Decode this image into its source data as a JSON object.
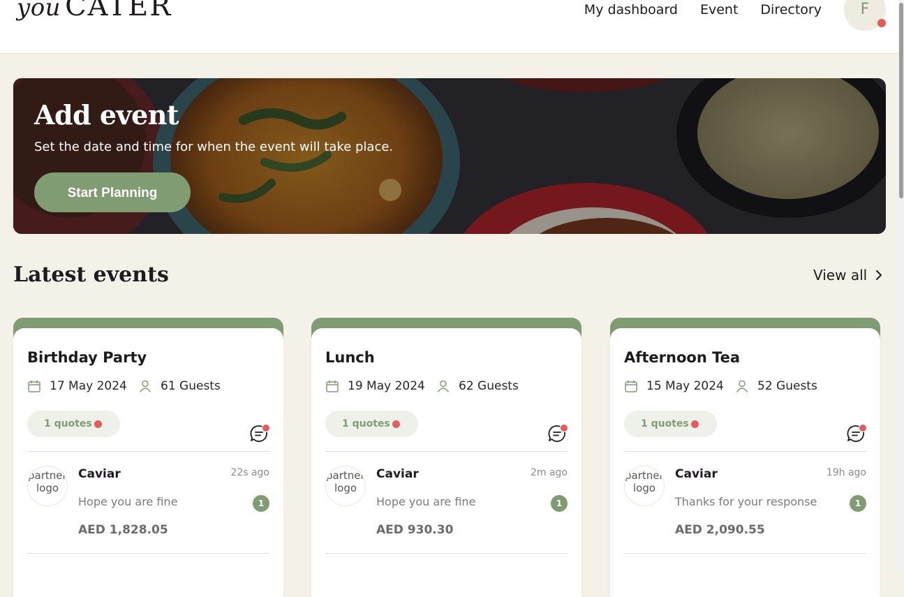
{
  "brand": {
    "logo_italic": "you",
    "logo_main": "CATER"
  },
  "nav": {
    "items": [
      "My dashboard",
      "Event",
      "Directory"
    ]
  },
  "user": {
    "initial": "F"
  },
  "hero": {
    "title": "Add event",
    "subtitle": "Set the date and time for when the event will take place.",
    "button": "Start Planning"
  },
  "latest": {
    "title": "Latest events",
    "view_all": "View all"
  },
  "colors": {
    "accent": "#7f9c73",
    "notification": "#e85a5a",
    "background": "#f4f1e8"
  },
  "events": [
    {
      "title": "Birthday Party",
      "date": "17 May 2024",
      "guests": "61 Guests",
      "quotes": "1 quotes",
      "partner_alt": "partner-logo",
      "partner": "Caviar",
      "time": "22s ago",
      "message": "Hope you are fine",
      "unread": "1",
      "price": "AED 1,828.05"
    },
    {
      "title": "Lunch",
      "date": "19 May 2024",
      "guests": "62 Guests",
      "quotes": "1 quotes",
      "partner_alt": "partner-logo",
      "partner": "Caviar",
      "time": "2m ago",
      "message": "Hope you are fine",
      "unread": "1",
      "price": "AED 930.30"
    },
    {
      "title": "Afternoon Tea",
      "date": "15 May 2024",
      "guests": "52 Guests",
      "quotes": "1 quotes",
      "partner_alt": "partner-logo",
      "partner": "Caviar",
      "time": "19h ago",
      "message": "Thanks for your response",
      "unread": "1",
      "price": "AED 2,090.55"
    }
  ]
}
